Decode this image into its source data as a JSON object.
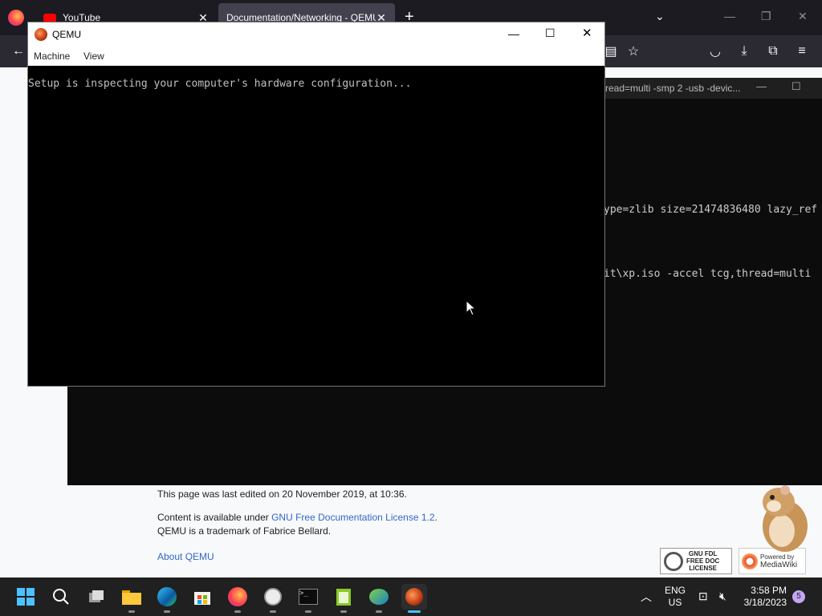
{
  "browser": {
    "tabs": [
      {
        "label": "YouTube"
      },
      {
        "label": "Documentation/Networking - QEMU"
      }
    ],
    "new_tab": "+"
  },
  "terminal": {
    "title": "read=multi -smp 2 -usb -devic...",
    "lines": [
      "ype=zlib size=21474836480 lazy_ref",
      "it\\xp.iso -accel tcg,thread=multi"
    ]
  },
  "page_footer": {
    "last_edited": "This page was last edited on 20 November 2019, at 10:36.",
    "content_prefix": "Content is available under ",
    "license_link": "GNU Free Documentation License 1.2",
    "content_suffix": ".",
    "trademark": "QEMU is a trademark of Fabrice Bellard.",
    "about_link": "About QEMU",
    "gfdl_badge": [
      "GNU FDL",
      "FREE DOC",
      "LICENSE"
    ],
    "mediawiki_badge": [
      "Powered by",
      "MediaWiki"
    ]
  },
  "qemu_window": {
    "title": "QEMU",
    "menu": [
      "Machine",
      "View"
    ],
    "screen_text": "Setup is inspecting your computer's hardware configuration..."
  },
  "taskbar": {
    "language": "ENG",
    "region": "US",
    "time": "3:58 PM",
    "date": "3/18/2023",
    "notification_count": "5"
  },
  "colors": {
    "accent": "#0078d4",
    "link": "#3366cc",
    "terminal_bg": "#0c0c0c"
  }
}
